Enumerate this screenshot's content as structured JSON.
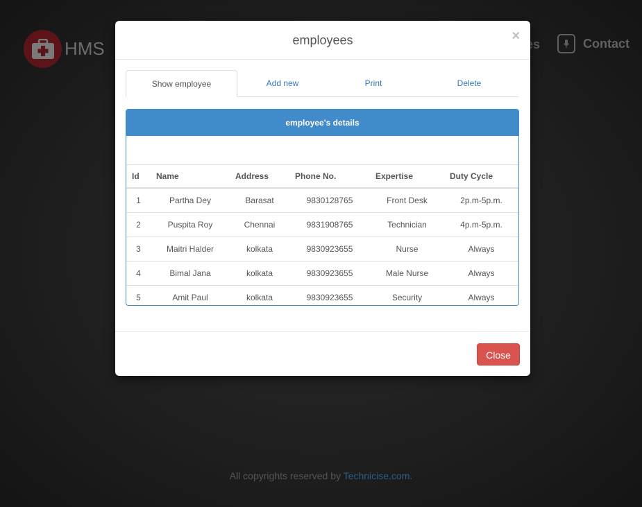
{
  "brand": {
    "name": "HMS"
  },
  "nav": {
    "partial_label": "es",
    "contact_label": "Contact"
  },
  "modal": {
    "title": "employees",
    "close_symbol": "×",
    "tabs": [
      {
        "label": "Show employee",
        "active": true
      },
      {
        "label": "Add new",
        "active": false
      },
      {
        "label": "Print",
        "active": false
      },
      {
        "label": "Delete",
        "active": false
      }
    ],
    "panel_title": "employee's details",
    "table": {
      "headers": [
        "Id",
        "Name",
        "Address",
        "Phone No.",
        "Expertise",
        "Duty Cycle"
      ],
      "rows": [
        [
          "1",
          "Partha Dey",
          "Barasat",
          "9830128765",
          "Front Desk",
          "2p.m-5p.m."
        ],
        [
          "2",
          "Puspita Roy",
          "Chennai",
          "9831908765",
          "Technician",
          "4p.m-5p.m."
        ],
        [
          "3",
          "Maitri Halder",
          "kolkata",
          "9830923655",
          "Nurse",
          "Always"
        ],
        [
          "4",
          "Bimal Jana",
          "kolkata",
          "9830923655",
          "Male Nurse",
          "Always"
        ],
        [
          "5",
          "Amit Paul",
          "kolkata",
          "9830923655",
          "Security",
          "Always"
        ]
      ]
    },
    "close_button": "Close"
  },
  "footer": {
    "text": "All copyrights reserved by ",
    "link": "Technicise.com",
    "suffix": "."
  },
  "colors": {
    "primary": "#428bca",
    "danger": "#d9534f",
    "logo": "#5c1418"
  }
}
